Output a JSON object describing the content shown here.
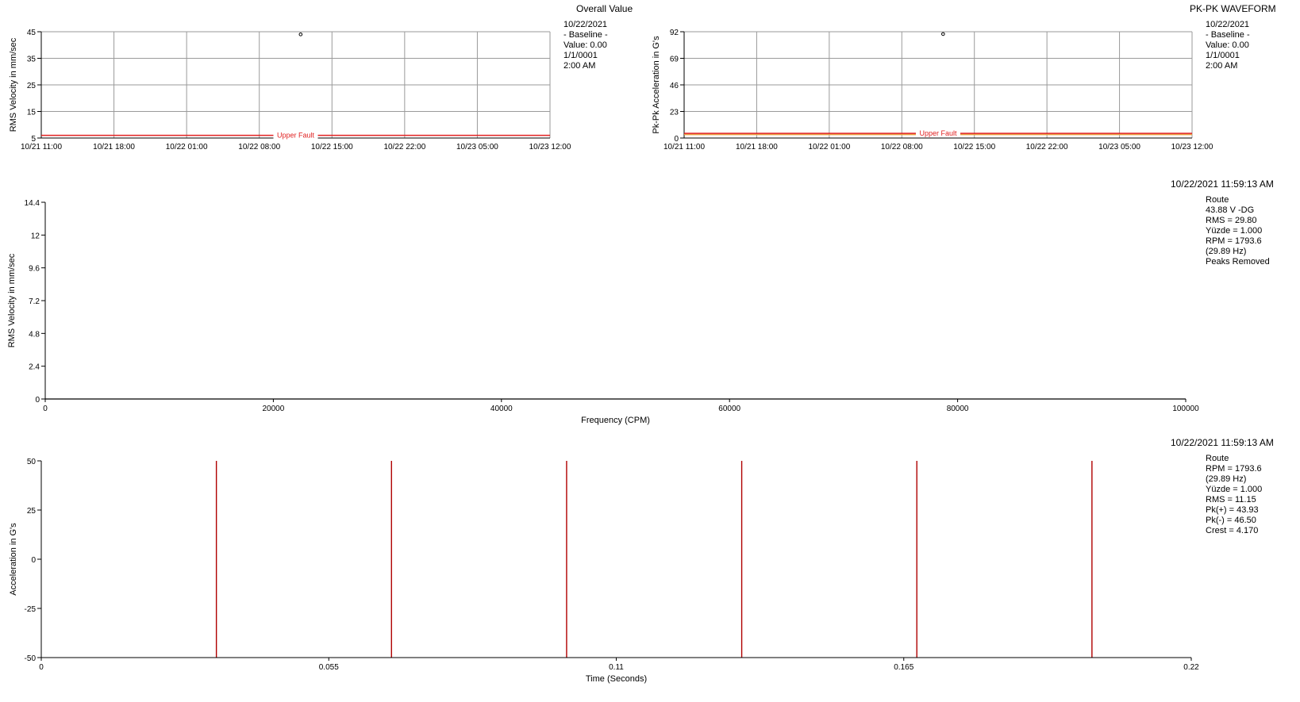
{
  "colors": {
    "axis": "#000000",
    "grid": "#9a9a9a",
    "fault": "#e02020",
    "alert": "#e8a040",
    "impulse": "#b00000"
  },
  "trend1": {
    "title": "Overall Value",
    "info": [
      "10/22/2021",
      "- Baseline -",
      "Value: 0.00",
      "1/1/0001",
      "2:00 AM"
    ],
    "fault_label": "Upper Fault"
  },
  "trend2": {
    "title": "PK-PK WAVEFORM",
    "info": [
      "10/22/2021",
      "- Baseline -",
      "Value: 0.00",
      "1/1/0001",
      "2:00 AM"
    ],
    "fault_label": "Upper Fault"
  },
  "spectrum": {
    "timestamp": "10/22/2021 11:59:13 AM",
    "info": [
      "Route",
      "43.88 V -DG",
      "RMS = 29.80",
      "Yüzde = 1.000",
      "RPM = 1793.6",
      "(29.89 Hz)",
      "Peaks Removed"
    ]
  },
  "waveform": {
    "timestamp": "10/22/2021 11:59:13 AM",
    "info": [
      "Route",
      "RPM = 1793.6",
      "(29.89 Hz)",
      "Yüzde = 1.000",
      "RMS = 11.15",
      "Pk(+) = 43.93",
      "Pk(-) = 46.50",
      "Crest = 4.170"
    ]
  },
  "chart_data": [
    {
      "type": "scatter",
      "title": "Overall Value",
      "ylabel": "RMS Velocity in mm/sec",
      "xlabel": "",
      "ylim": [
        5,
        45
      ],
      "yticks": [
        5,
        15,
        25,
        35,
        45
      ],
      "xtick_labels": [
        "10/21 11:00",
        "10/21 18:00",
        "10/22 01:00",
        "10/22 08:00",
        "10/22 15:00",
        "10/22 22:00",
        "10/23 05:00",
        "10/23 12:00"
      ],
      "points": [
        {
          "x": "10/22 11:59",
          "y": 44
        }
      ],
      "fault_level": 6.0,
      "fault_label": "Upper Fault",
      "grid": true
    },
    {
      "type": "scatter",
      "title": "PK-PK WAVEFORM",
      "ylabel": "Pk-Pk Acceleration in G's",
      "xlabel": "",
      "ylim": [
        0,
        92
      ],
      "yticks": [
        0,
        23,
        46,
        69,
        92
      ],
      "xtick_labels": [
        "10/21 11:00",
        "10/21 18:00",
        "10/22 01:00",
        "10/22 08:00",
        "10/22 15:00",
        "10/22 22:00",
        "10/23 05:00",
        "10/23 12:00"
      ],
      "points": [
        {
          "x": "10/22 11:59",
          "y": 90
        }
      ],
      "fault_level": 4.0,
      "alert_level": 3.0,
      "fault_label": "Upper Fault",
      "grid": true
    },
    {
      "type": "line",
      "title": "",
      "ylabel": "RMS Velocity in mm/sec",
      "xlabel": "Frequency (CPM)",
      "xlim": [
        0,
        100000
      ],
      "ylim": [
        0,
        14.4
      ],
      "xticks": [
        0,
        20000,
        40000,
        60000,
        80000,
        100000
      ],
      "yticks": [
        0,
        2.4,
        4.8,
        7.2,
        9.6,
        12,
        14.4
      ],
      "series": [
        {
          "values": [
            [
              0,
              0
            ],
            [
              100000,
              0
            ]
          ]
        }
      ],
      "grid": false
    },
    {
      "type": "line",
      "title": "",
      "ylabel": "Acceleration in G's",
      "xlabel": "Time (Seconds)",
      "xlim": [
        0,
        0.22
      ],
      "ylim": [
        -50,
        50
      ],
      "xticks": [
        0,
        0.055,
        0.11,
        0.165,
        0.22
      ],
      "yticks": [
        -50,
        -25,
        0,
        25,
        50
      ],
      "impulses_x": [
        0.0335,
        0.067,
        0.1005,
        0.134,
        0.1675,
        0.201
      ],
      "grid": false
    }
  ]
}
